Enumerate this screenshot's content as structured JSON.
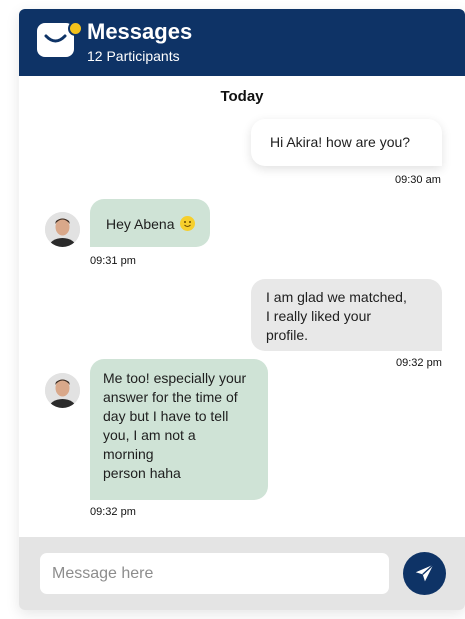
{
  "header": {
    "title": "Messages",
    "participants": "12 Participants",
    "logo_icon": "mail-icon",
    "color": "#0e3366",
    "badge_color": "#f3c21b"
  },
  "day_label": "Today",
  "messages": [
    {
      "direction": "out",
      "text": "Hi Akira! how are you?",
      "time": "09:30 am"
    },
    {
      "direction": "in",
      "text": "Hey Abena",
      "emoji": "smile-emoji",
      "time": "09:31 pm"
    },
    {
      "direction": "out",
      "lines": [
        "I am glad we matched,",
        "I really liked your",
        "profile."
      ],
      "time": "09:32 pm"
    },
    {
      "direction": "in",
      "lines": [
        "Me too! especially your",
        "answer for the time of",
        "day but I have to tell",
        "you, I am not a",
        "morning",
        "person haha"
      ],
      "time": "09:32 pm"
    }
  ],
  "composer": {
    "placeholder": "Message here",
    "send_icon": "send-icon"
  },
  "colors": {
    "incoming_bubble": "#cfe3d6",
    "outgoing_bubble": "#e8e8e8",
    "footer": "#e4e4e4"
  }
}
